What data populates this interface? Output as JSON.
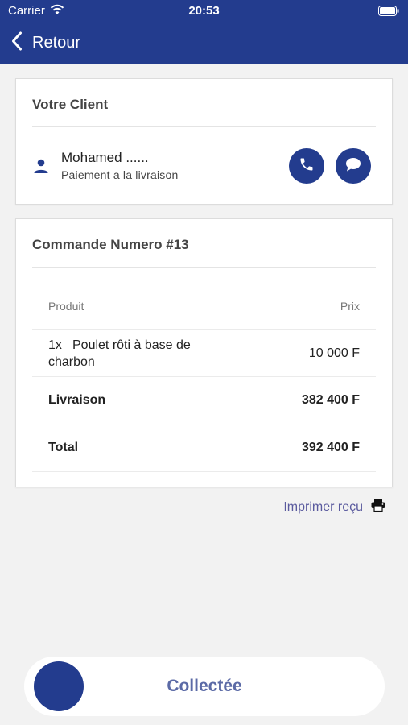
{
  "status_bar": {
    "carrier": "Carrier",
    "time": "20:53"
  },
  "nav": {
    "back_label": "Retour"
  },
  "client_card": {
    "title": "Votre Client",
    "client_name": "Mohamed ......",
    "payment_method": "Paiement a la livraison"
  },
  "order_card": {
    "title": "Commande Numero #13",
    "headers": {
      "product": "Produit",
      "price": "Prix"
    },
    "items": [
      {
        "qty": "1x",
        "name_line1": "Poulet rôti à base de",
        "name_line2": "charbon",
        "price": "10 000 F"
      }
    ],
    "delivery": {
      "label": "Livraison",
      "amount": "382 400 F"
    },
    "total": {
      "label": "Total",
      "amount": "392 400 F"
    }
  },
  "print": {
    "label": "Imprimer reçu"
  },
  "slider": {
    "label": "Collectée"
  },
  "colors": {
    "primary": "#233c8e",
    "background": "#f2f2f2",
    "link": "#5a5a9e"
  }
}
